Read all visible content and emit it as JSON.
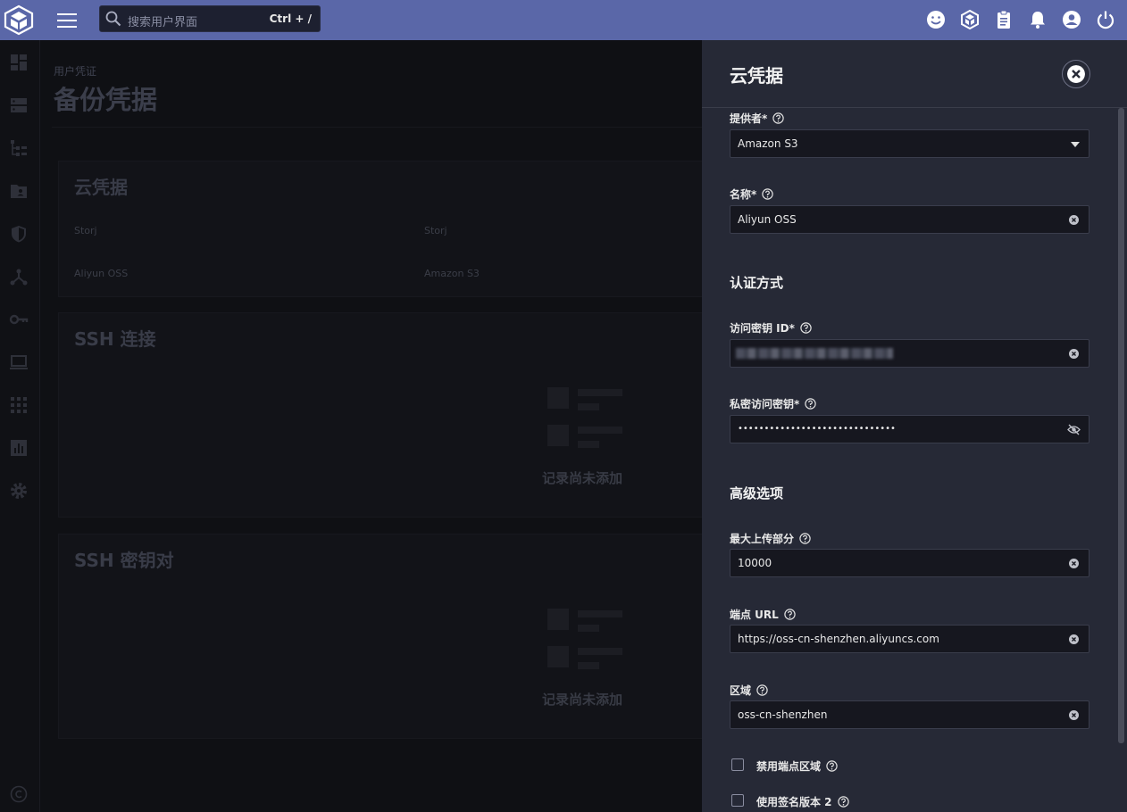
{
  "topbar": {
    "search_placeholder": "搜索用户界面",
    "search_shortcut": "Ctrl + /",
    "icons": [
      "feedback-icon",
      "truecommand-icon",
      "jobs-icon",
      "alerts-icon",
      "account-icon",
      "power-icon"
    ]
  },
  "sidebar": {
    "icons": [
      "dashboard-icon",
      "storage-icon",
      "datasets-icon",
      "shares-icon",
      "data-protection-icon",
      "network-icon",
      "credentials-icon",
      "virtualization-icon",
      "apps-icon",
      "reporting-icon",
      "system-settings-icon"
    ]
  },
  "main": {
    "breadcrumb": "用户凭证",
    "title": "备份凭据",
    "cloud_card": {
      "title": "云凭据",
      "rows": [
        {
          "name": "Storj",
          "provider": "Storj"
        },
        {
          "name": "Aliyun OSS",
          "provider": "Amazon S3"
        }
      ]
    },
    "ssh_conn_card": {
      "title": "SSH 连接",
      "empty_text": "记录尚未添加"
    },
    "ssh_key_card": {
      "title": "SSH 密钥对",
      "empty_text": "记录尚未添加"
    }
  },
  "panel": {
    "title": "云凭据",
    "provider": {
      "label": "提供者",
      "required": "*",
      "value": "Amazon S3"
    },
    "name": {
      "label": "名称",
      "required": "*",
      "value": "Aliyun OSS"
    },
    "auth_section": "认证方式",
    "access_key_id": {
      "label": "访问密钥 ID",
      "required": "*"
    },
    "secret_key": {
      "label": "私密访问密钥",
      "required": "*",
      "value": "••••••••••••••••••••••••••••••"
    },
    "advanced_section": "高级选项",
    "max_upload_parts": {
      "label": "最大上传部分",
      "value": "10000"
    },
    "endpoint_url": {
      "label": "端点 URL",
      "value": "https://oss-cn-shenzhen.aliyuncs.com"
    },
    "region": {
      "label": "区域",
      "value": "oss-cn-shenzhen"
    },
    "disable_endpoint_region": {
      "label": "禁用端点区域",
      "checked": false
    },
    "use_signature_v2": {
      "label": "使用签名版本 2",
      "checked": false
    }
  }
}
